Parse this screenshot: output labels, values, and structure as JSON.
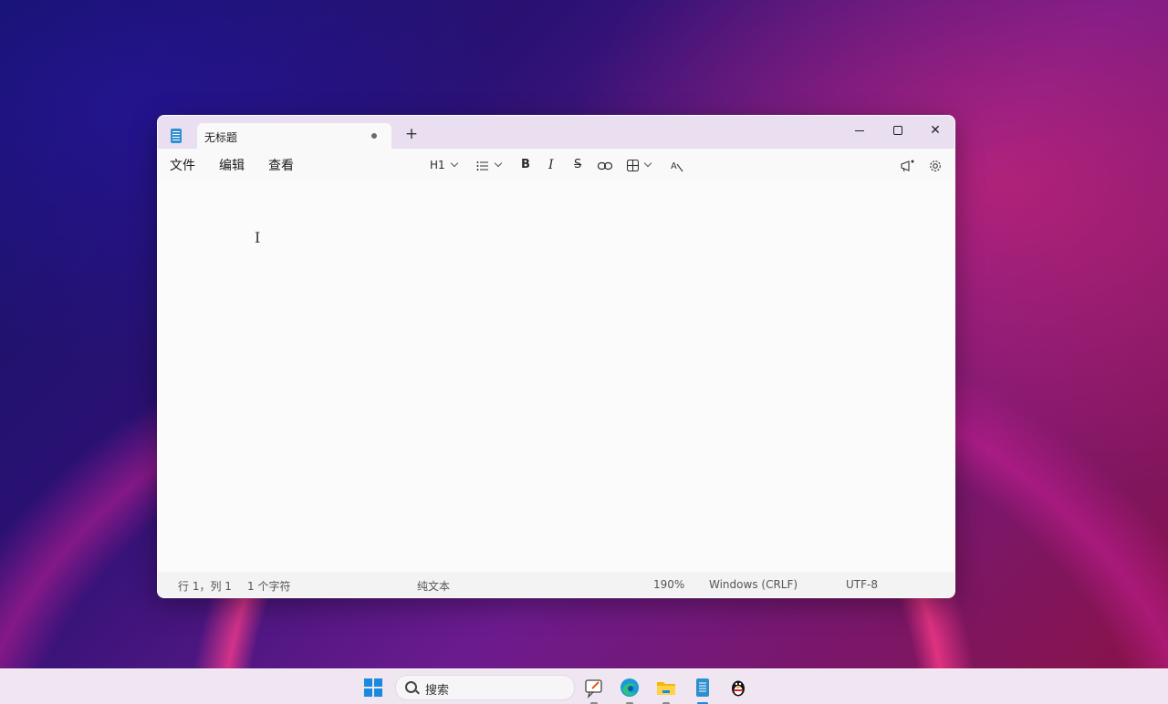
{
  "window": {
    "tab_title": "无标题",
    "add_tab_glyph": "+",
    "close_glyph": "✕"
  },
  "menu": {
    "file": "文件",
    "edit": "编辑",
    "view": "查看"
  },
  "toolbar": {
    "heading_label": "H1",
    "bold_glyph": "B",
    "italic_glyph": "I",
    "strike_glyph": "S"
  },
  "editor": {
    "caret_glyph": "I"
  },
  "status": {
    "position": "行 1，列 1",
    "char_count": "1 个字符",
    "format": "纯文本",
    "zoom": "190%",
    "line_ending": "Windows (CRLF)",
    "encoding": "UTF-8"
  },
  "taskbar": {
    "search_placeholder": "搜索",
    "apps": [
      "start-icon",
      "search-icon",
      "feedback-icon",
      "edge-icon",
      "file-explorer-icon",
      "notepad-icon",
      "qq-icon"
    ]
  },
  "colors": {
    "accent": "#1a8ae0",
    "titlebar": "#eadff0",
    "taskbar": "#efe6f2"
  }
}
